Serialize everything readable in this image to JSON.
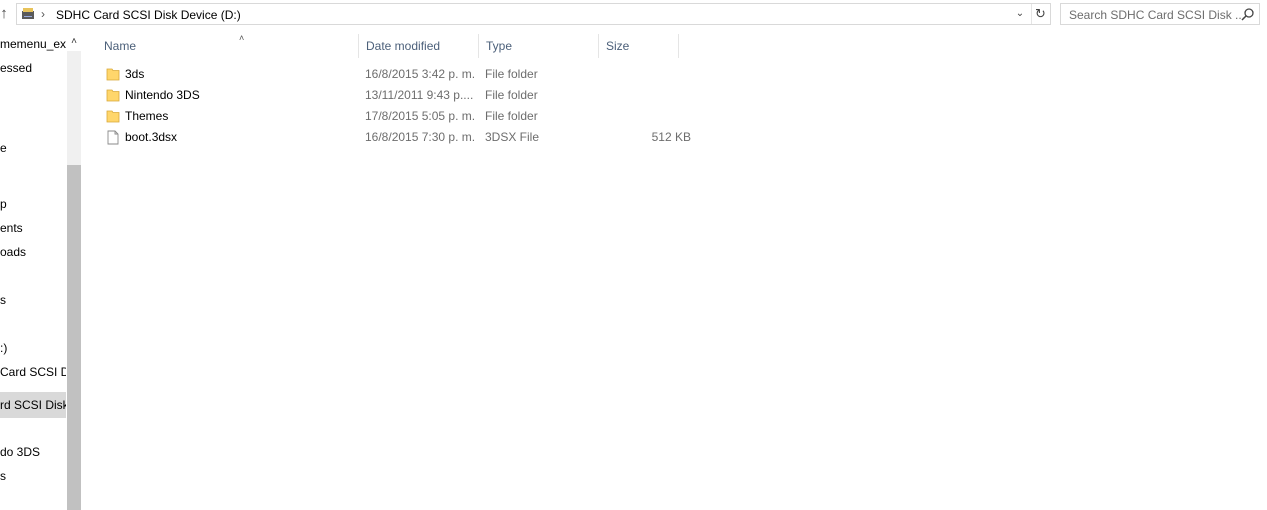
{
  "address_bar": {
    "path": "SDHC Card SCSI Disk Device (D:)",
    "separator": "›",
    "up_icon": "arrow-up-icon",
    "drive_icon": "sd-card-drive-icon",
    "dropdown_icon": "chevron-down-icon",
    "refresh_icon": "refresh-icon"
  },
  "search": {
    "placeholder": "Search SDHC Card SCSI Disk ...",
    "icon": "search-icon"
  },
  "nav_pane": {
    "items": [
      {
        "label": "memenu_ext",
        "selected": false
      },
      {
        "label": "essed",
        "selected": false
      },
      {
        "label": "e",
        "selected": false
      },
      {
        "label": "p",
        "selected": false
      },
      {
        "label": "ents",
        "selected": false
      },
      {
        "label": "oads",
        "selected": false
      },
      {
        "label": "s",
        "selected": false
      },
      {
        "label": ":)",
        "selected": false
      },
      {
        "label": "Card SCSI Dis",
        "selected": false
      },
      {
        "label": "rd SCSI Disk",
        "selected": true
      },
      {
        "label": "do 3DS",
        "selected": false
      },
      {
        "label": "s",
        "selected": false
      }
    ]
  },
  "columns": {
    "name": "Name",
    "date": "Date modified",
    "type": "Type",
    "size": "Size"
  },
  "files": [
    {
      "name": "3ds",
      "date": "16/8/2015 3:42 p. m.",
      "type": "File folder",
      "size": "",
      "icon": "folder-icon"
    },
    {
      "name": "Nintendo 3DS",
      "date": "13/11/2011 9:43 p....",
      "type": "File folder",
      "size": "",
      "icon": "folder-icon"
    },
    {
      "name": "Themes",
      "date": "17/8/2015 5:05 p. m.",
      "type": "File folder",
      "size": "",
      "icon": "folder-icon"
    },
    {
      "name": "boot.3dsx",
      "date": "16/8/2015 7:30 p. m.",
      "type": "3DSX File",
      "size": "512 KB",
      "icon": "file-icon"
    }
  ],
  "colors": {
    "header_text": "#4c607a",
    "folder_yellow": "#ffd66b",
    "selected_bg": "#d9d9d9"
  }
}
